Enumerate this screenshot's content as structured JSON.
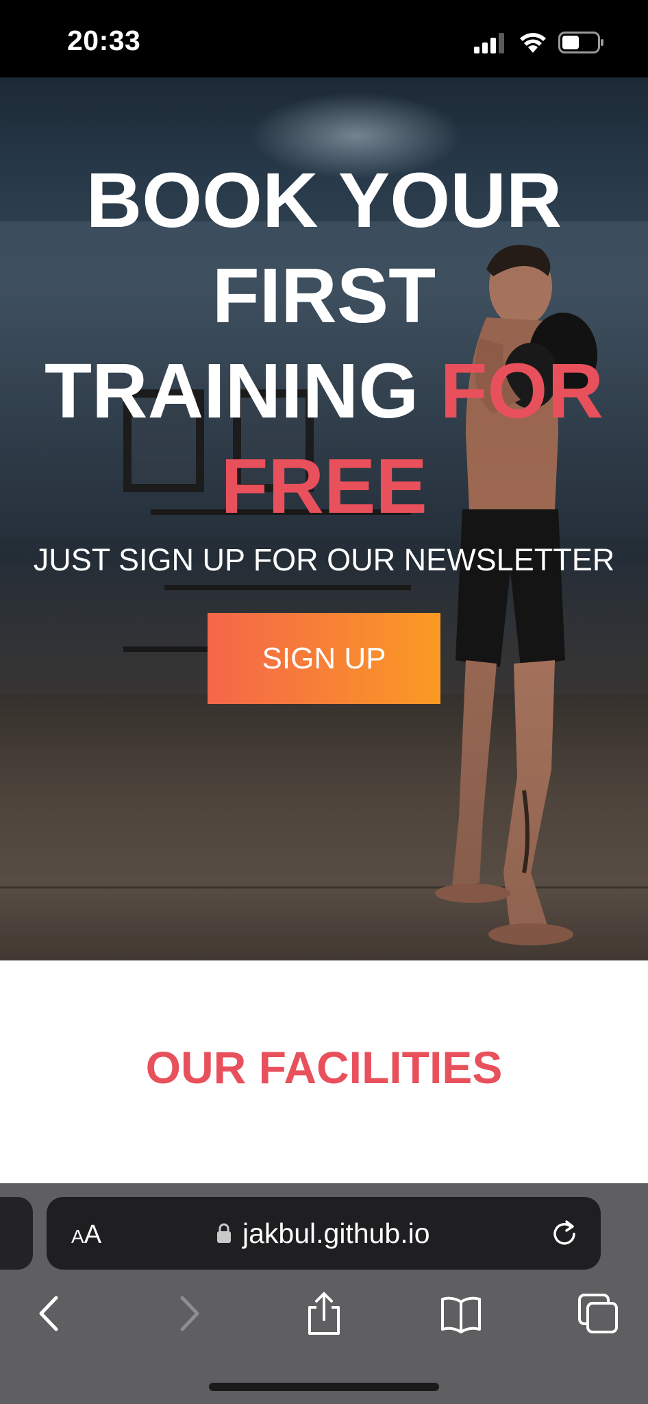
{
  "status_bar": {
    "time": "20:33"
  },
  "hero": {
    "title_line1": "BOOK YOUR",
    "title_line2": "FIRST",
    "title_line3_white": "TRAINING",
    "title_line3_accent": "FOR",
    "title_line4_accent": "FREE",
    "subtitle": "JUST SIGN UP FOR OUR NEWSLETTER",
    "cta_label": "SIGN UP",
    "accent_color": "#e8505b",
    "button_gradient": [
      "#f4664a",
      "#fb9a23"
    ]
  },
  "facilities": {
    "title": "OUR FACILITIES"
  },
  "browser": {
    "text_size_label": "AA",
    "url": "jakbul.github.io",
    "icons": [
      "lock-icon",
      "reload-icon",
      "back-icon",
      "forward-icon",
      "share-icon",
      "bookmarks-icon",
      "tabs-icon"
    ]
  }
}
